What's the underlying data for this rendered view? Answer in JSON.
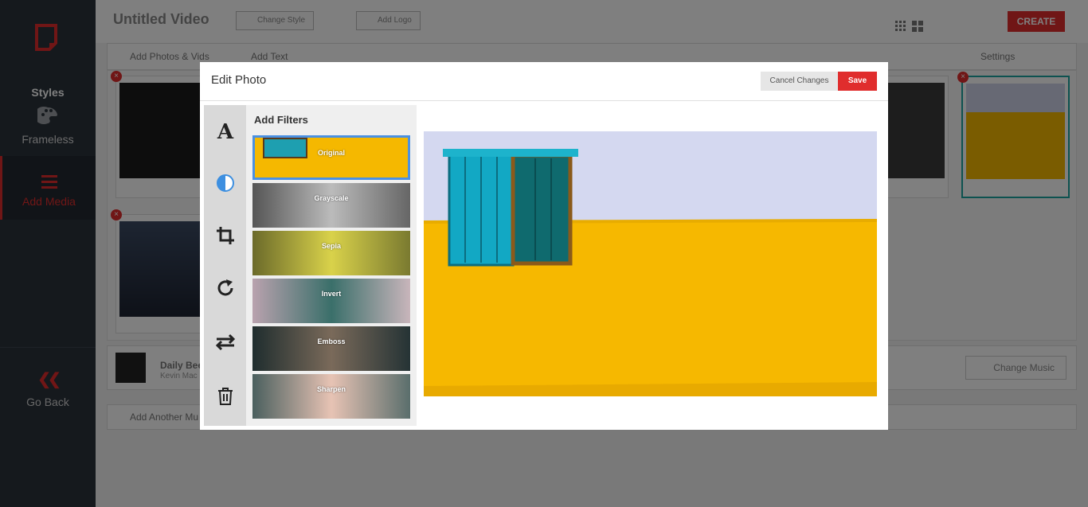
{
  "sidebar": {
    "styles_label": "Styles",
    "frameless_label": "Frameless",
    "add_media_label": "Add Media",
    "go_back_label": "Go Back"
  },
  "header": {
    "title": "Untitled Video",
    "change_style_label": "Change Style",
    "add_logo_label": "Add Logo",
    "create_label": "CREATE"
  },
  "toolbar": {
    "add_photos_label": "Add Photos & Vids",
    "add_text_label": "Add Text",
    "settings_label": "Settings"
  },
  "music": {
    "title": "Daily Bee",
    "artist": "Kevin Mac",
    "change_music_label": "Change Music",
    "add_another_label": "Add Another Mu"
  },
  "modal": {
    "title": "Edit Photo",
    "cancel_label": "Cancel Changes",
    "save_label": "Save",
    "filters_heading": "Add Filters",
    "filters": [
      {
        "label": "Original"
      },
      {
        "label": "Grayscale"
      },
      {
        "label": "Sepia"
      },
      {
        "label": "Invert"
      },
      {
        "label": "Emboss"
      },
      {
        "label": "Sharpen"
      }
    ],
    "tools": [
      "text-tool-icon",
      "filter-tool-icon",
      "crop-tool-icon",
      "rotate-tool-icon",
      "flip-tool-icon",
      "delete-tool-icon"
    ]
  },
  "colors": {
    "accent": "#e02d2d",
    "sidebar_bg": "#2b323b",
    "selected_filter": "#4a90e2",
    "tool_active": "#4a90e2"
  }
}
